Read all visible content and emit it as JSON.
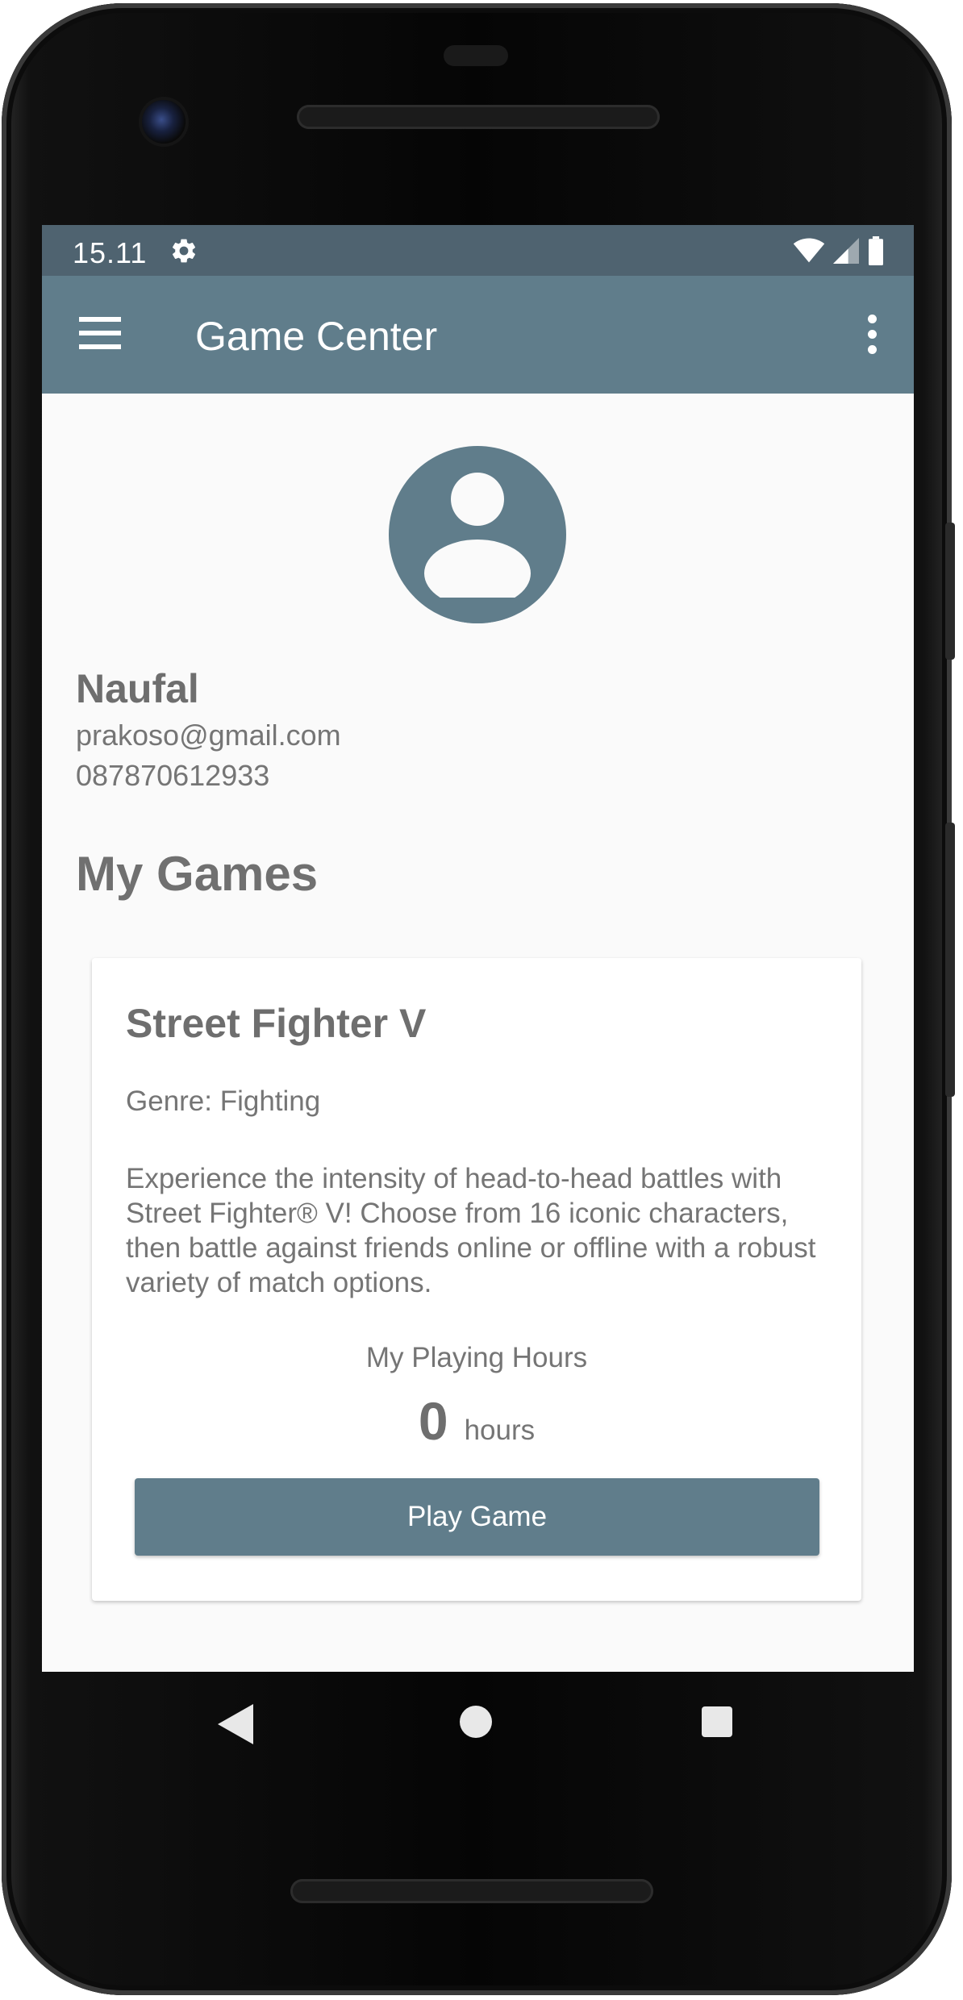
{
  "status_bar": {
    "time": "15.11",
    "icons": [
      "gear-icon",
      "wifi-icon",
      "signal-icon",
      "battery-icon"
    ]
  },
  "app_bar": {
    "title": "Game Center",
    "left_icon": "menu-icon",
    "right_icon": "more-vert-icon",
    "color": "#607d8b"
  },
  "profile": {
    "avatar_icon": "account-circle-icon",
    "name": "Naufal",
    "email": "prakoso@gmail.com",
    "phone": "087870612933"
  },
  "my_games": {
    "section_title": "My Games",
    "games": [
      {
        "title": "Street Fighter V",
        "genre": "Genre: Fighting",
        "description": "Experience the intensity of head-to-head battles with Street Fighter® V! Choose from 16 iconic characters, then battle against friends online or offline with a robust variety of match options.",
        "hours_label": "My Playing Hours",
        "hours_value": "0",
        "hours_unit": "hours",
        "button_label": "Play Game"
      }
    ]
  },
  "nav_bar": {
    "icons": [
      "back-icon",
      "home-icon",
      "recents-icon"
    ]
  }
}
